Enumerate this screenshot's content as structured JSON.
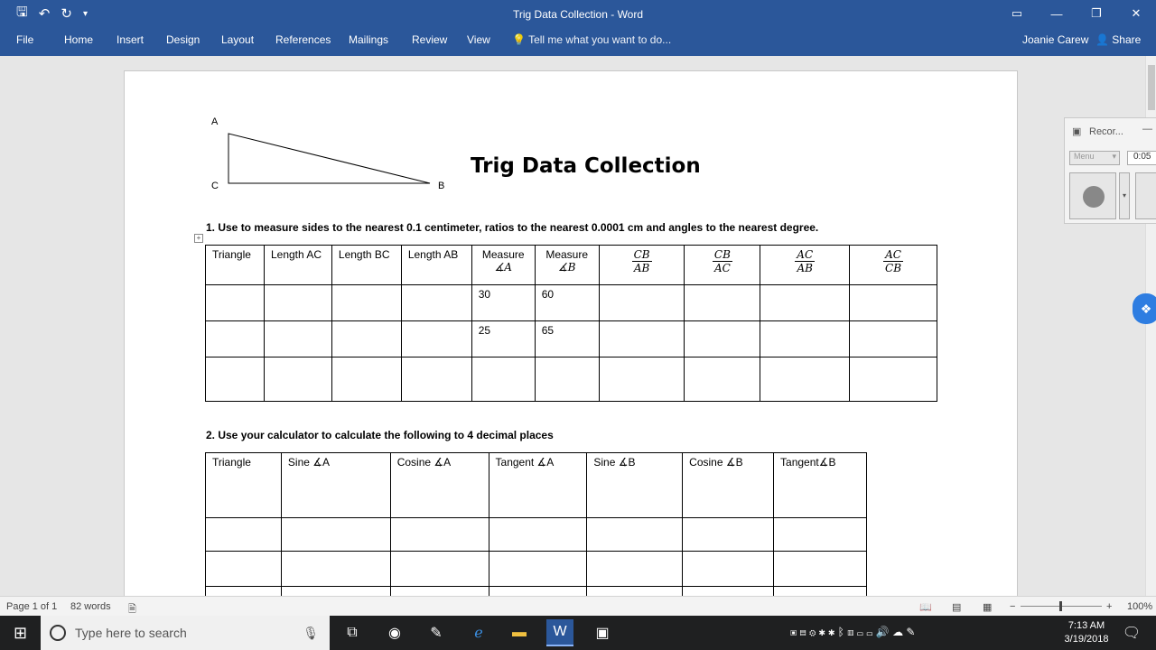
{
  "window": {
    "title": "Trig Data Collection - Word",
    "user": "Joanie Carew",
    "share_label": "Share",
    "tell_me_placeholder": "Tell me what you want to do..."
  },
  "ribbon": {
    "tabs": [
      "File",
      "Home",
      "Insert",
      "Design",
      "Layout",
      "References",
      "Mailings",
      "Review",
      "View"
    ]
  },
  "document": {
    "triangle_labels": {
      "a": "A",
      "b": "B",
      "c": "C"
    },
    "heading": "Trig Data Collection",
    "instruction1": "1. Use to measure sides to the nearest 0.1 centimeter, ratios to the nearest 0.0001 cm and angles to the nearest degree.",
    "instruction2": "2. Use your calculator to calculate the following to 4 decimal places",
    "table1": {
      "headers": {
        "triangle": "Triangle",
        "length_ac": "Length AC",
        "length_bc": "Length BC",
        "length_ab": "Length AB",
        "measure_a": {
          "line1": "Measure",
          "line2": "∡A"
        },
        "measure_b": {
          "line1": "Measure",
          "line2": "∡B"
        },
        "ratio1": {
          "num": "CB",
          "den": "AB"
        },
        "ratio2": {
          "num": "CB",
          "den": "AC"
        },
        "ratio3": {
          "num": "AC",
          "den": "AB"
        },
        "ratio4": {
          "num": "AC",
          "den": "CB"
        }
      },
      "rows": [
        {
          "measure_a": "30",
          "measure_b": "60"
        },
        {
          "measure_a": "25",
          "measure_b": "65"
        },
        {
          "measure_a": "",
          "measure_b": ""
        }
      ]
    },
    "table2": {
      "headers": [
        "Triangle",
        "Sine ∡A",
        "Cosine ∡A",
        "Tangent ∡A",
        "Sine ∡B",
        "Cosine ∡B",
        "Tangent∡B"
      ],
      "row_count": 3
    }
  },
  "recorder": {
    "title": "Recor...",
    "menu_label": "Menu",
    "time": "0:05"
  },
  "statusbar": {
    "page": "Page 1 of 1",
    "words": "82 words",
    "zoom": "100%"
  },
  "taskbar": {
    "search_placeholder": "Type here to search",
    "time": "7:13 AM",
    "date": "3/19/2018"
  }
}
